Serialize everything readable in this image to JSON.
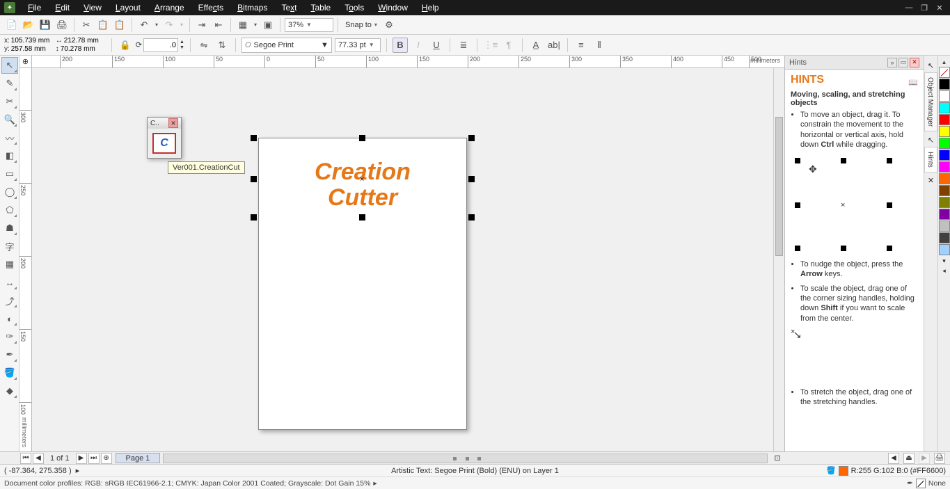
{
  "menubar": {
    "items": [
      "File",
      "Edit",
      "View",
      "Layout",
      "Arrange",
      "Effects",
      "Bitmaps",
      "Text",
      "Table",
      "Tools",
      "Window",
      "Help"
    ]
  },
  "toolbar1": {
    "zoom": "37%",
    "snap_label": "Snap to"
  },
  "propbar": {
    "x_label": "x:",
    "y_label": "y:",
    "x": "105.739 mm",
    "y": "257.58 mm",
    "w": "212.78 mm",
    "h": "70.278 mm",
    "rotation": ".0",
    "font": "Segoe Print",
    "font_size": "77.33 pt",
    "bold_label": "B",
    "italic_label": "I",
    "under_label": "U",
    "ab_label": "ab|"
  },
  "ruler": {
    "units": "millimeters",
    "h_ticks": [
      "200",
      "150",
      "100",
      "50",
      "0",
      "50",
      "100",
      "150",
      "200",
      "250",
      "300",
      "350",
      "400",
      "450",
      "500"
    ],
    "v_ticks": [
      "300",
      "250",
      "200",
      "150",
      "100"
    ]
  },
  "plugin": {
    "title": "C..",
    "tooltip": "Ver001.CreationCut"
  },
  "canvas": {
    "text_line1": "Creation",
    "text_line2": "Cutter"
  },
  "docker": {
    "tab_title": "Hints",
    "heading": "HINTS",
    "subtitle": "Moving, scaling, and stretching objects",
    "tip1_pre": "To move an object, drag it. To constrain the movement to the horizontal or vertical axis, hold down ",
    "tip1_key": "Ctrl",
    "tip1_post": " while dragging.",
    "tip2_pre": "To nudge the object, press the ",
    "tip2_key": "Arrow",
    "tip2_post": " keys.",
    "tip3_pre": "To scale the object, drag one of the corner sizing handles, holding down ",
    "tip3_key": "Shift",
    "tip3_post": " if you want to scale from the center.",
    "tip4": "To stretch the object, drag one of the stretching handles."
  },
  "vtabs": {
    "tab1": "Object Manager",
    "tab2": "Hints"
  },
  "pagenav": {
    "counter": "1 of 1",
    "tab": "Page 1"
  },
  "status1": {
    "coords": "( -87.364, 275.358 )",
    "center": "Artistic Text: Segoe Print (Bold) (ENU) on Layer 1",
    "color_info": "R:255 G:102 B:0 (#FF6600)"
  },
  "status2": {
    "profiles": "Document color profiles: RGB: sRGB IEC61966-2.1; CMYK: Japan Color 2001 Coated; Grayscale: Dot Gain 15%",
    "fill_none": "None"
  },
  "palette": {
    "colors": [
      "#000000",
      "#ffffff",
      "#00ffff",
      "#ff0000",
      "#ffff00",
      "#00ff00",
      "#0000ff",
      "#ff00ff",
      "#ff6600",
      "#804000",
      "#808000",
      "#8000a0",
      "#c0c0c0",
      "#404040",
      "#a0d0ff"
    ]
  }
}
